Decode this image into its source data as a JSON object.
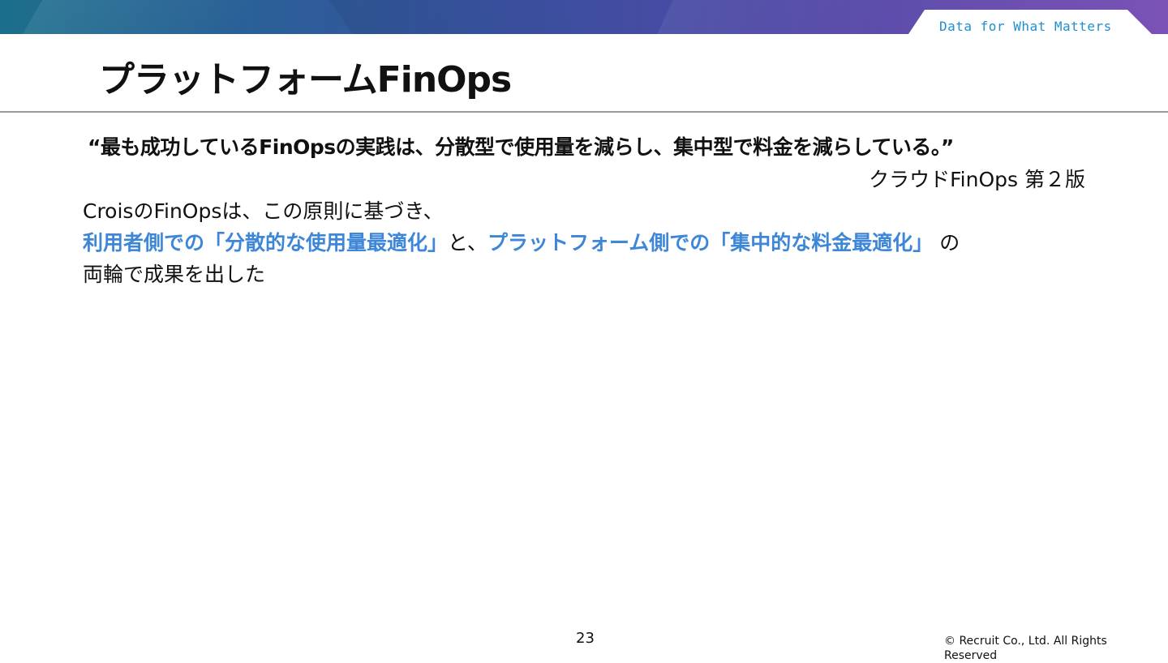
{
  "header": {
    "tagline": "Data for What Matters",
    "title": "プラットフォームFinOps"
  },
  "quote": {
    "text": "“最も成功しているFinOpsの実践は、分散型で使用量を減らし、集中型で料金を減らしている。”",
    "source": "クラウドFinOps 第２版"
  },
  "body": {
    "line1": "CroisのFinOpsは、この原則に基づき、",
    "highlight1": "利用者側での「分散的な使用量最適化」",
    "connector": "と、",
    "highlight2": "プラットフォーム側での「集中的な料金最適化」",
    "suffix": " の",
    "line3": "両輪で成果を出した"
  },
  "footer": {
    "page_number": "23",
    "copyright": "© Recruit Co., Ltd. All Rights Reserved"
  },
  "colors": {
    "highlight": "#3d86d8",
    "tagline": "#1e8fd0"
  }
}
